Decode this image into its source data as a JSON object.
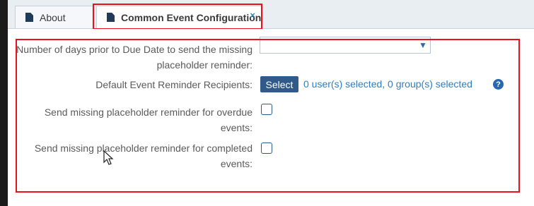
{
  "tabs": [
    {
      "label": "About",
      "icon": "document-icon"
    },
    {
      "label": "Common Event Configuration",
      "icon": "document-icon",
      "close": "×"
    }
  ],
  "form": {
    "days_label": "Number of days prior to Due Date to send the missing placeholder reminder:",
    "days_value": "",
    "recipients_label": "Default Event Reminder Recipients:",
    "select_button": "Select",
    "recipients_summary": "0 user(s) selected, 0 group(s) selected",
    "help_glyph": "?",
    "overdue_label": "Send missing placeholder reminder for overdue events:",
    "overdue_checked": false,
    "completed_label": "Send missing placeholder reminder for completed events:",
    "completed_checked": false
  },
  "colors": {
    "accent": "#2f5a8a",
    "link": "#2f7dc0",
    "highlight_outline": "#e8121a"
  }
}
